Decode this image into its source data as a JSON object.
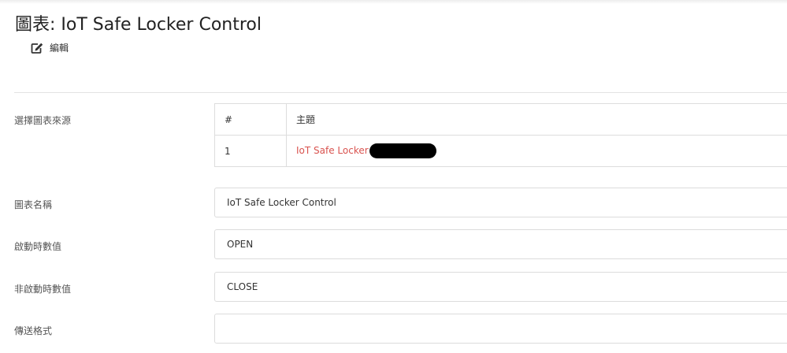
{
  "page": {
    "title": "圖表: IoT Safe Locker Control",
    "edit_label": "編輯"
  },
  "source": {
    "label": "選擇圖表來源",
    "table": {
      "headers": [
        "#",
        "主題"
      ],
      "rows": [
        {
          "num": "1",
          "topic": "IoT Safe Locker"
        }
      ]
    }
  },
  "fields": {
    "chart_name": {
      "label": "圖表名稱",
      "value": "IoT Safe Locker Control"
    },
    "active_value": {
      "label": "啟動時數值",
      "value": "OPEN"
    },
    "inactive_value": {
      "label": "非啟動時數值",
      "value": "CLOSE"
    },
    "send_format": {
      "label": "傳送格式",
      "value": ""
    }
  },
  "colors": {
    "topic_link": "#d9534f",
    "border": "#dddddd",
    "redaction": "#000000"
  },
  "icons": {
    "edit": "pencil-square-icon"
  }
}
